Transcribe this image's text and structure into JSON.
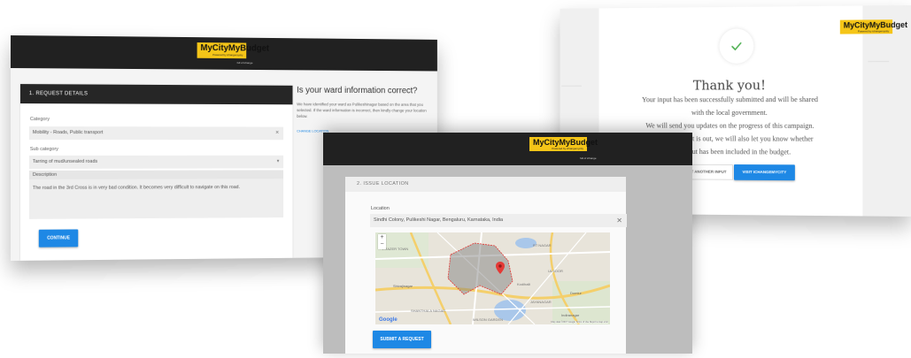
{
  "request_details": {
    "brand": {
      "logo_text": "MyCityMyBudget",
      "tagline": "Powered by ichangemycity",
      "below": "full of ichange"
    },
    "section_title": "1.   REQUEST DETAILS",
    "category": {
      "label": "Category",
      "value": "Mobility - Roads, Public transport",
      "trail": "✕"
    },
    "sub_category": {
      "label": "Sub category",
      "value": "Tarring of mud/unsealed roads",
      "trail": "▾"
    },
    "description": {
      "label": "Description",
      "value": "The road in the 3rd Cross is in very bad condition. It becomes very difficult to navigate on this road."
    },
    "continue_button": "CONTINUE",
    "ward": {
      "title": "Is your ward information correct?",
      "text": "We have identified your ward as Pulikeshinagar based on the area that you selected. If the ward information is incorrect, then kindly change your location below.",
      "link": "CHANGE LOCATION"
    }
  },
  "thank_you": {
    "brand": {
      "logo_text": "MyCityMyBudget",
      "tagline": "Powered by ichangemycity"
    },
    "check_icon": "check-icon",
    "title": "Thank you!",
    "lines": [
      "Your input has been successfully submitted and will be shared",
      "with the local government.",
      "We will send you updates on the progress of this campaign.",
      "When the budget is out, we will also let you know whether",
      "your input has been included in the budget."
    ],
    "buttons": {
      "another": "SUBMIT ANOTHER INPUT",
      "visit": "VISIT ICHANGEMYCITY"
    },
    "accent": "#4caf50"
  },
  "issue_location": {
    "brand": {
      "logo_text": "MyCityMyBudget",
      "tagline": "Powered by ichangemycity",
      "below": "full of ichange"
    },
    "section_title": "2.   ISSUE LOCATION",
    "location": {
      "label": "Location",
      "value": "Sindhi Colony, Pulikeshi Nagar, Bengaluru, Karnataka, India",
      "clear_icon": "close-icon"
    },
    "map": {
      "zoom_in": "+",
      "zoom_out": "−",
      "google": "Google",
      "attribution": "Map data ©2017 Google   Terms of Use   Report a map error",
      "place_labels": [
        "FRAZER TOWN",
        "RT NAGAR",
        "Shivajinagar",
        "SHANTHALA NAGAR",
        "WILSON GARDEN",
        "ULSOOR",
        "JAYANAGAR",
        "Domlur",
        "Indiranagar",
        "Kodihalli"
      ]
    },
    "submit_button": "SUBMIT A REQUEST"
  },
  "colors": {
    "primary": "#1e88e5",
    "dark_bar": "#212121",
    "brand_yellow": "#f5c518",
    "pin": "#e53935"
  }
}
